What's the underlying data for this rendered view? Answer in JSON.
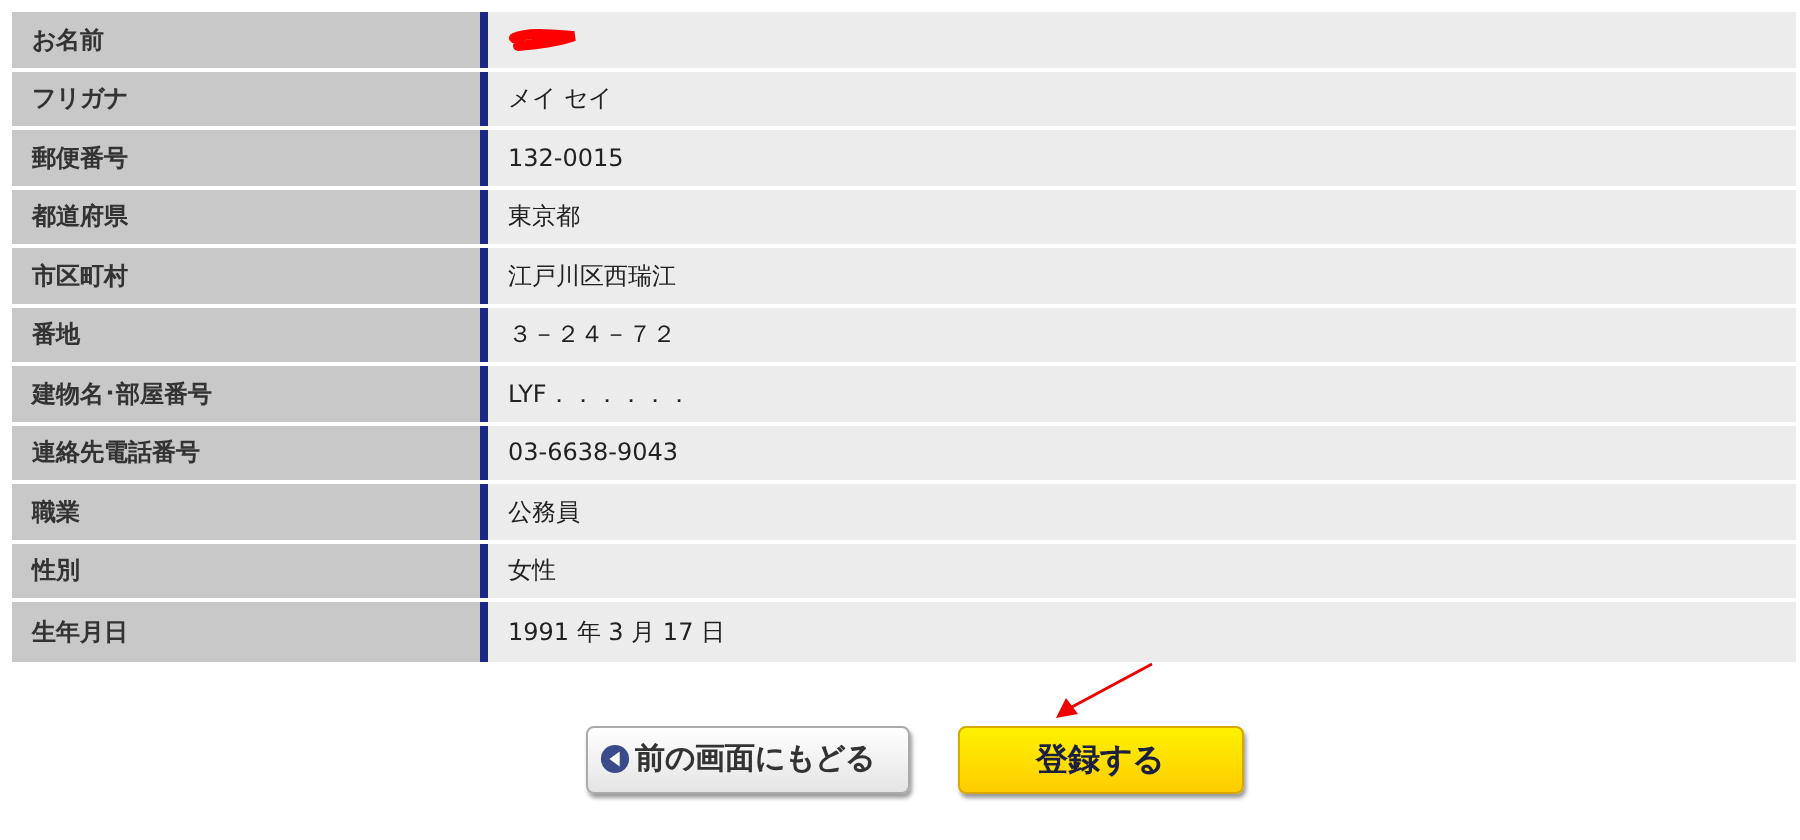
{
  "rows": [
    {
      "label": "お名前",
      "redacted": true
    },
    {
      "label": "フリガナ",
      "value": "メイ セイ",
      "redacted": false
    },
    {
      "label": "郵便番号",
      "value": "132-0015",
      "redacted": false
    },
    {
      "label": "都道府県",
      "value": "東京都",
      "redacted": false
    },
    {
      "label": "市区町村",
      "value": "江戸川区西瑞江",
      "redacted": false
    },
    {
      "label": "番地",
      "value": "３－２４－７２",
      "redacted": false
    },
    {
      "label": "建物名･部屋番号",
      "value": "LYF．．．．．．",
      "redacted": false
    },
    {
      "label": "連絡先電話番号",
      "value": "03-6638-9043",
      "redacted": false
    },
    {
      "label": "職業",
      "value": "公務員",
      "redacted": false
    },
    {
      "label": "性別",
      "value": "女性",
      "redacted": false
    },
    {
      "label": "生年月日",
      "value": "1991 年 3 月 17 日",
      "redacted": false
    }
  ],
  "buttons": [
    {
      "kind": "back",
      "label": "前の画面にもどる"
    },
    {
      "kind": "submit",
      "label": "登録する"
    }
  ],
  "annotation": {
    "kind": "arrow"
  }
}
